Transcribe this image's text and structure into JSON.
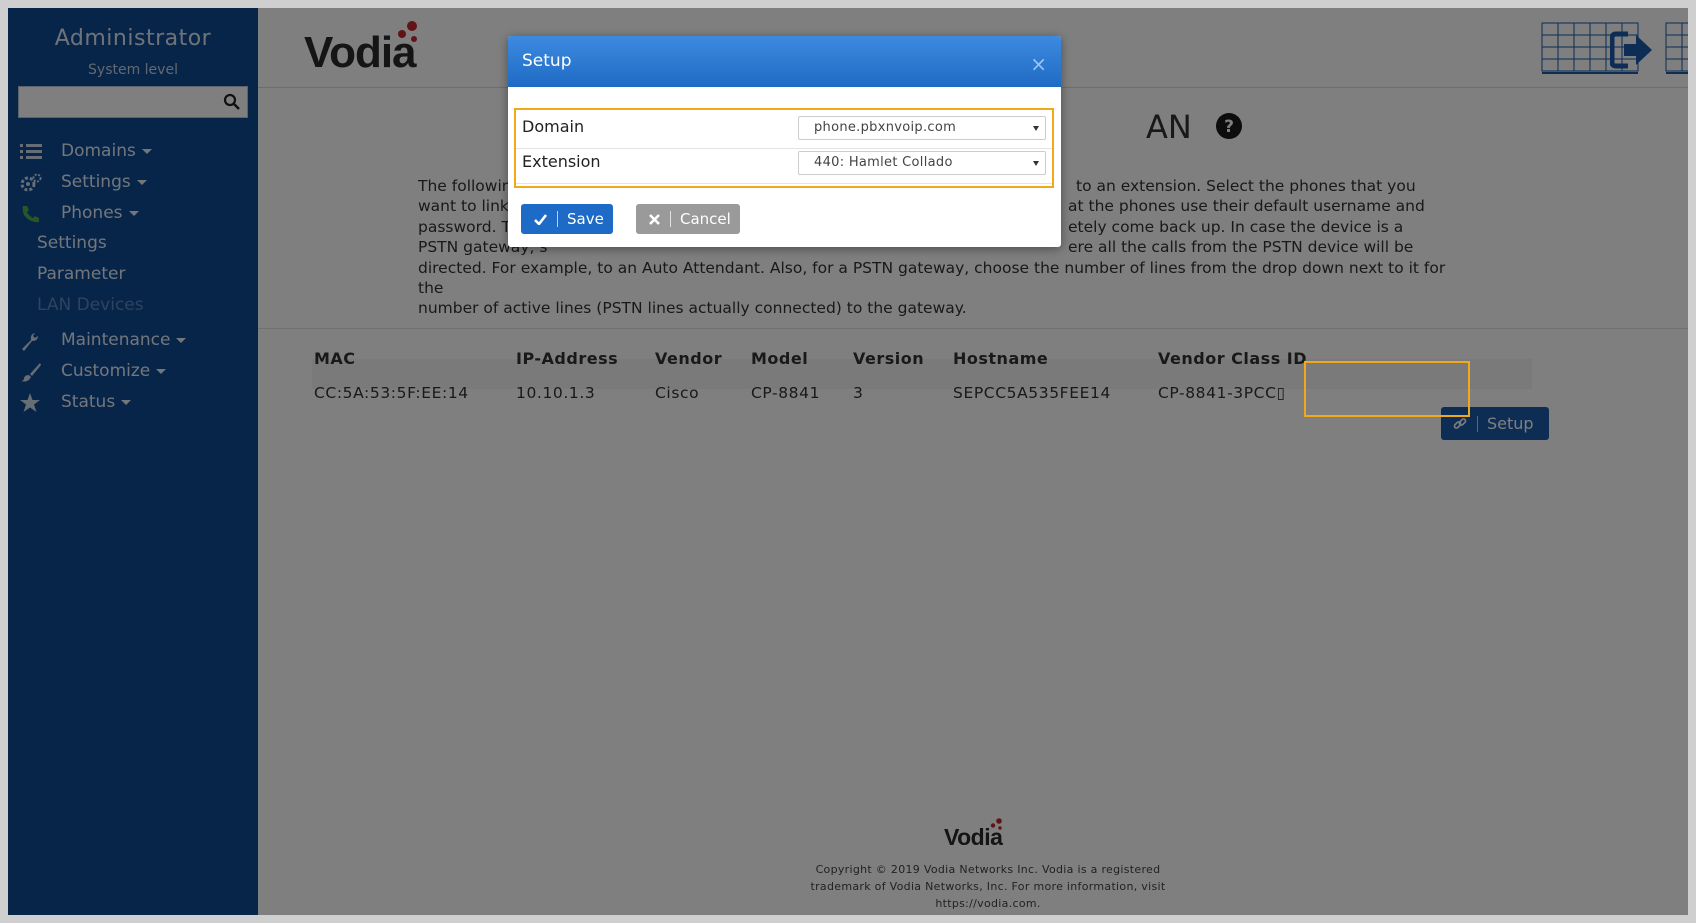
{
  "sidebar": {
    "title": "Administrator",
    "subtitle": "System level",
    "search_placeholder": "",
    "items": [
      {
        "label": "Domains",
        "icon": "list-icon"
      },
      {
        "label": "Settings",
        "icon": "gears-icon"
      },
      {
        "label": "Phones",
        "icon": "phone-icon"
      }
    ],
    "sub_items": [
      "Settings",
      "Parameter",
      "LAN Devices"
    ],
    "items_after": [
      {
        "label": "Maintenance",
        "icon": "wrench-icon"
      },
      {
        "label": "Customize",
        "icon": "brush-icon"
      },
      {
        "label": "Status",
        "icon": "star-icon"
      }
    ],
    "color": "#0e4a93"
  },
  "header": {
    "logo": "Vodia"
  },
  "page": {
    "title_visible": "AN",
    "intro_lines": [
      "The following ta",
      "want to link, a d",
      "password. There",
      "PSTN gateway, s",
      "directed. For example, to an Auto Attendant. Also, for a PSTN gateway, choose the number of lines from the drop down next to it for the",
      "number of active lines (PSTN lines actually connected) to the gateway."
    ],
    "intro_right_lines": [
      "to an extension. Select the phones that you",
      "at the phones use their default username and",
      "etely come back up. In case the device is a",
      "ere all the calls from the PSTN device will be"
    ]
  },
  "table": {
    "headers": [
      "MAC",
      "IP-Address",
      "Vendor",
      "Model",
      "Version",
      "Hostname",
      "Vendor Class ID"
    ],
    "rows": [
      [
        "CC:5A:53:5F:EE:14",
        "10.10.1.3",
        "Cisco",
        "CP-8841",
        "3",
        "SEPCC5A535FEE14",
        "CP-8841-3PCC▯"
      ]
    ],
    "row_button": "Setup"
  },
  "footer": {
    "logo": "Vodia",
    "lines": [
      "Copyright © 2019 Vodia Networks Inc. Vodia is a registered",
      "trademark of Vodia Networks, Inc. For more information, visit",
      "https://vodia.com."
    ]
  },
  "modal": {
    "title": "Setup",
    "close": "×",
    "domain_label": "Domain",
    "domain_value": "phone.pbxnvoip.com",
    "extension_label": "Extension",
    "extension_value": "440: Hamlet Collado",
    "save_label": "Save",
    "cancel_label": "Cancel"
  },
  "colors": {
    "accent": "#1d6ac7",
    "highlight": "#f0a91a"
  }
}
